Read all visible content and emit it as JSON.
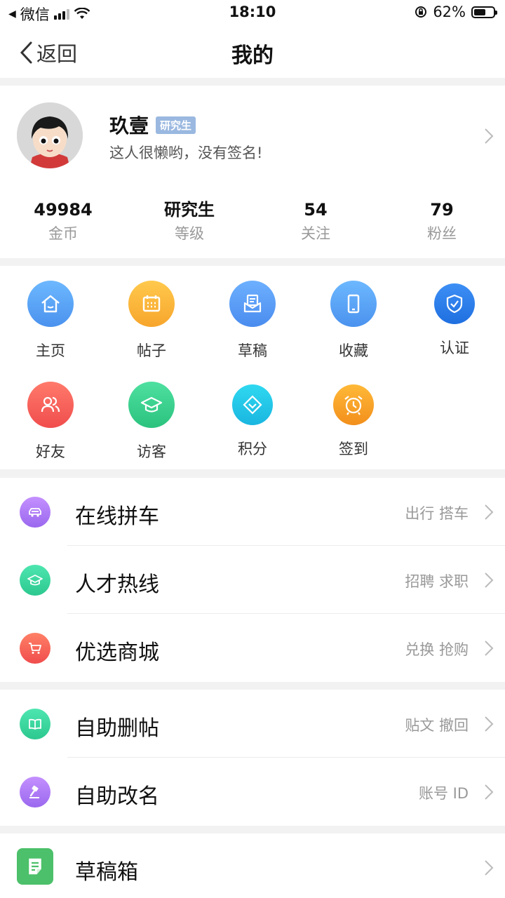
{
  "status_bar": {
    "carrier": "微信",
    "time": "18:10",
    "battery_pct": "62%",
    "battery_level": 0.62
  },
  "nav": {
    "back_label": "返回",
    "title": "我的"
  },
  "profile": {
    "name": "玖壹",
    "badge": "研究生",
    "bio": "这人很懒哟，没有签名!",
    "stats": [
      {
        "value": "49984",
        "label": "金币"
      },
      {
        "value": "研究生",
        "label": "等级"
      },
      {
        "value": "54",
        "label": "关注"
      },
      {
        "value": "79",
        "label": "粉丝"
      }
    ]
  },
  "shortcuts": [
    {
      "label": "主页",
      "icon": "home-icon",
      "color": "#5aa9f5"
    },
    {
      "label": "帖子",
      "icon": "calendar-icon",
      "color": "#f8b63a"
    },
    {
      "label": "草稿",
      "icon": "mail-icon",
      "color": "#5a9df0"
    },
    {
      "label": "收藏",
      "icon": "phone-icon",
      "color": "#5aa9f5"
    },
    {
      "label": "认证",
      "icon": "shield-icon",
      "color": "#2f7ee8"
    },
    {
      "label": "好友",
      "icon": "friends-icon",
      "color": "#f5665a"
    },
    {
      "label": "访客",
      "icon": "graduation-cap-icon",
      "color": "#3ccf8e"
    },
    {
      "label": "积分",
      "icon": "diamond-icon",
      "color": "#1ec8e0"
    },
    {
      "label": "签到",
      "icon": "alarm-clock-icon",
      "color": "#f7a52c"
    }
  ],
  "menu_group_1": [
    {
      "label": "在线拼车",
      "sub": "出行  搭车",
      "icon": "car-icon",
      "color": "#b07cf0"
    },
    {
      "label": "人才热线",
      "sub": "招聘  求职",
      "icon": "graduation-cap-icon",
      "color": "#3ccf9e"
    },
    {
      "label": "优选商城",
      "sub": "兑换  抢购",
      "icon": "cart-icon",
      "color": "#f5665a"
    }
  ],
  "menu_group_2": [
    {
      "label": "自助删帖",
      "sub": "贴文  撤回",
      "icon": "book-icon",
      "color": "#3ccf9e"
    },
    {
      "label": "自助改名",
      "sub": "账号  ID",
      "icon": "gavel-icon",
      "color": "#a87cf0"
    }
  ],
  "menu_group_3": [
    {
      "label": "草稿箱",
      "icon": "note-icon",
      "color": "#4cc06a"
    }
  ]
}
